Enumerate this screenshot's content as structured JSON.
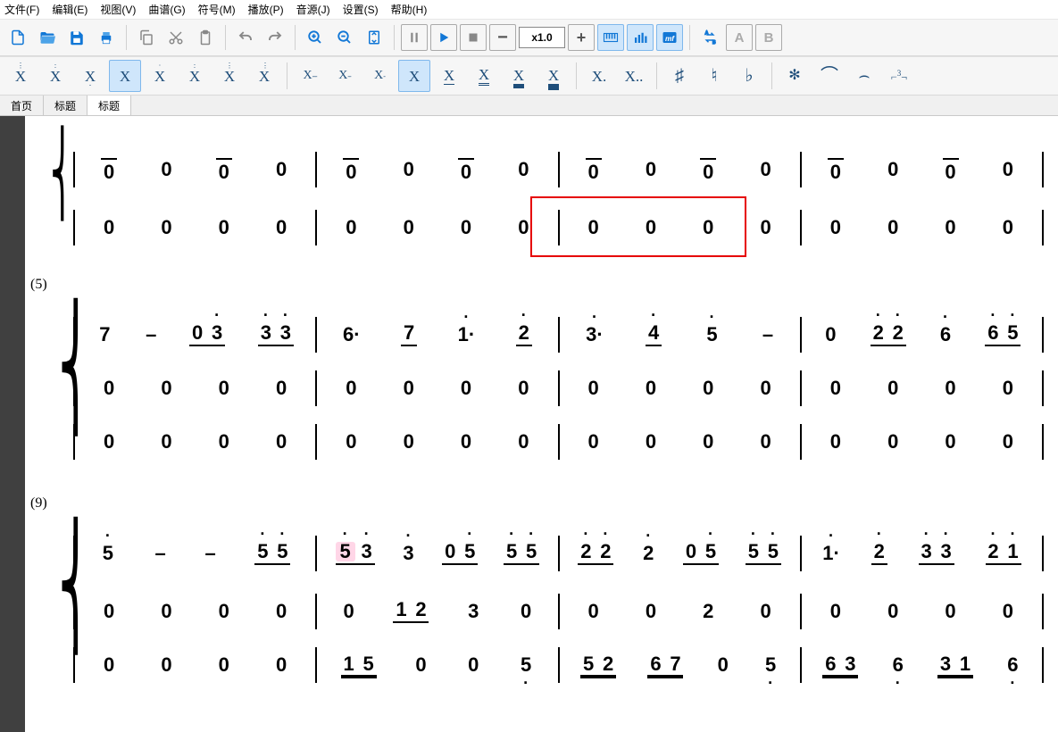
{
  "menu": {
    "file": "文件(F)",
    "edit": "编辑(E)",
    "view": "视图(V)",
    "score": "曲谱(G)",
    "symbol": "符号(M)",
    "play": "播放(P)",
    "audio": "音源(J)",
    "settings": "设置(S)",
    "help": "帮助(H)"
  },
  "zoom": "x1.0",
  "tabs": [
    "首页",
    "标题",
    "标题"
  ],
  "activeTab": 2,
  "measureNums": [
    "(5)",
    "(9)"
  ],
  "notation_toolbar": [
    "X⋮",
    "X⋮",
    "X̲",
    "X",
    "Ẋ",
    "Ẍ",
    "X⋮",
    "X⋮",
    "X---",
    "X--",
    "X-",
    "X",
    "X̲",
    "X̳",
    "X≡",
    "X≣",
    "X.",
    "X..",
    "♯",
    "♮",
    "♭",
    "✻",
    "⌒",
    "⌢",
    "⌐³¬"
  ],
  "sheet": {
    "system1": {
      "staff1": [
        [
          "0",
          "0",
          "0",
          "0"
        ],
        [
          "0",
          "0",
          "0",
          "0"
        ],
        [
          "0",
          "0",
          "0",
          "0"
        ],
        [
          "0",
          "0",
          "0",
          "0"
        ]
      ],
      "staff2": [
        [
          "0",
          "0",
          "0",
          "0"
        ],
        [
          "0",
          "0",
          "0",
          "0"
        ],
        [
          "0",
          "0",
          "0",
          "0"
        ],
        [
          "0",
          "0",
          "0",
          "0"
        ]
      ]
    },
    "system2": {
      "staff1": [
        [
          "7",
          "–",
          [
            "0",
            "3̇"
          ],
          [
            "3̇",
            "3̇"
          ]
        ],
        [
          "6·",
          "7̲",
          "1̇·",
          "2̲̇"
        ],
        [
          "3̇·",
          "4̲̇",
          "5̇",
          "–"
        ],
        [
          "0",
          [
            "2̇",
            "2̇"
          ],
          "6̇",
          [
            "6̇",
            "5̇"
          ]
        ]
      ],
      "staff2": [
        [
          "0",
          "0",
          "0",
          "0"
        ],
        [
          "0",
          "0",
          "0",
          "0"
        ],
        [
          "0",
          "0",
          "0",
          "0"
        ],
        [
          "0",
          "0",
          "0",
          "0"
        ]
      ],
      "staff3": [
        [
          "0",
          "0",
          "0",
          "0"
        ],
        [
          "0",
          "0",
          "0",
          "0"
        ],
        [
          "0",
          "0",
          "0",
          "0"
        ],
        [
          "0",
          "0",
          "0",
          "0"
        ]
      ]
    },
    "system3": {
      "staff1": [
        [
          "5̇",
          "–",
          "–",
          [
            "5̇",
            "5̇"
          ]
        ],
        [
          [
            "5̇!",
            "3̇"
          ],
          "3̇",
          [
            "0",
            "5̇"
          ],
          [
            "5̇",
            "5̇"
          ]
        ],
        [
          [
            "2̇",
            "2̇"
          ],
          "2̇",
          [
            "0",
            "5̇"
          ],
          [
            "5̇",
            "5̇"
          ]
        ],
        [
          "1̇·",
          "2̲̇",
          [
            "3̇",
            "3̇"
          ],
          [
            "2̇",
            "1̇"
          ]
        ]
      ],
      "staff2": [
        [
          "0",
          "0",
          "0",
          "0"
        ],
        [
          "0",
          [
            "1",
            "2"
          ],
          "3",
          "0"
        ],
        [
          "0",
          "0",
          "2",
          "0"
        ],
        [
          "0",
          "0",
          "0",
          "0"
        ]
      ],
      "staff3": [
        [
          "0",
          "0",
          "0",
          "0"
        ],
        [
          [
            "1",
            "5"
          ],
          "0",
          "0",
          "5̣"
        ],
        [
          [
            "5",
            "2"
          ],
          [
            "6",
            "7"
          ],
          "0",
          "5̣"
        ],
        [
          [
            "6",
            "3"
          ],
          "6̣",
          [
            "3",
            "1"
          ],
          "6̣"
        ]
      ]
    }
  }
}
